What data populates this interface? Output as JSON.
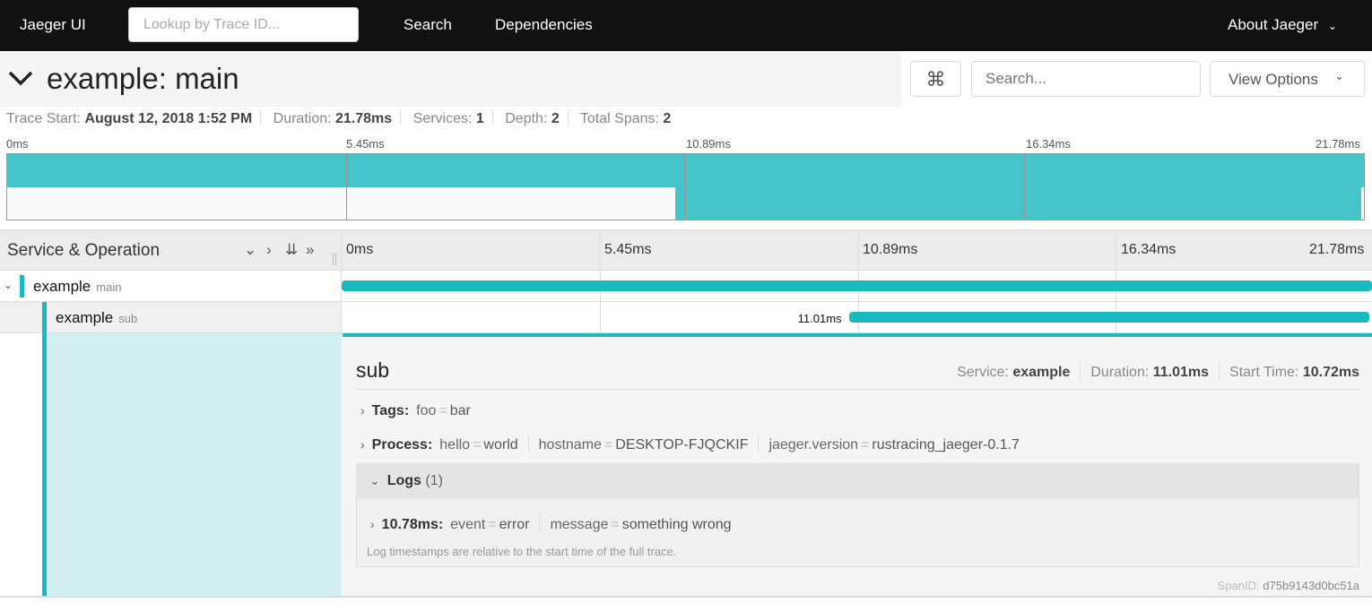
{
  "nav": {
    "brand": "Jaeger UI",
    "lookup_placeholder": "Lookup by Trace ID...",
    "search": "Search",
    "dependencies": "Dependencies",
    "about": "About Jaeger"
  },
  "header": {
    "title": "example: main",
    "search_placeholder": "Search...",
    "view_options": "View Options",
    "shortcut_icon": "command-icon"
  },
  "meta": {
    "trace_start_label": "Trace Start:",
    "trace_start": "August 12, 2018 1:52 PM",
    "duration_label": "Duration:",
    "duration": "21.78ms",
    "services_label": "Services:",
    "services": "1",
    "depth_label": "Depth:",
    "depth": "2",
    "spans_label": "Total Spans:",
    "spans": "2"
  },
  "ticks": [
    "0ms",
    "5.45ms",
    "10.89ms",
    "16.34ms",
    "21.78ms"
  ],
  "timeline": {
    "header": "Service & Operation",
    "total_ms": 21.78
  },
  "spans": [
    {
      "service": "example",
      "operation": "main",
      "start_ms": 0,
      "duration_ms": 21.78
    },
    {
      "service": "example",
      "operation": "sub",
      "start_ms": 10.72,
      "duration_ms": 11.01,
      "label": "11.01ms"
    }
  ],
  "colors": {
    "accent": "#19b9c0",
    "minimap": "#45c4c9",
    "nav": "#111111"
  },
  "detail": {
    "title": "sub",
    "service_label": "Service:",
    "service": "example",
    "duration_label": "Duration:",
    "duration": "11.01ms",
    "start_label": "Start Time:",
    "start": "10.72ms",
    "tags_label": "Tags:",
    "tags": [
      {
        "k": "foo",
        "v": "bar"
      }
    ],
    "process_label": "Process:",
    "process": [
      {
        "k": "hello",
        "v": "world"
      },
      {
        "k": "hostname",
        "v": "DESKTOP-FJQCKIF"
      },
      {
        "k": "jaeger.version",
        "v": "rustracing_jaeger-0.1.7"
      }
    ],
    "logs_label": "Logs",
    "logs_count": "(1)",
    "log": {
      "time": "10.78ms:",
      "fields": [
        {
          "k": "event",
          "v": "error"
        },
        {
          "k": "message",
          "v": "something wrong"
        }
      ]
    },
    "log_note": "Log timestamps are relative to the start time of the full trace.",
    "spanid_label": "SpanID:",
    "spanid": "d75b9143d0bc51a"
  }
}
